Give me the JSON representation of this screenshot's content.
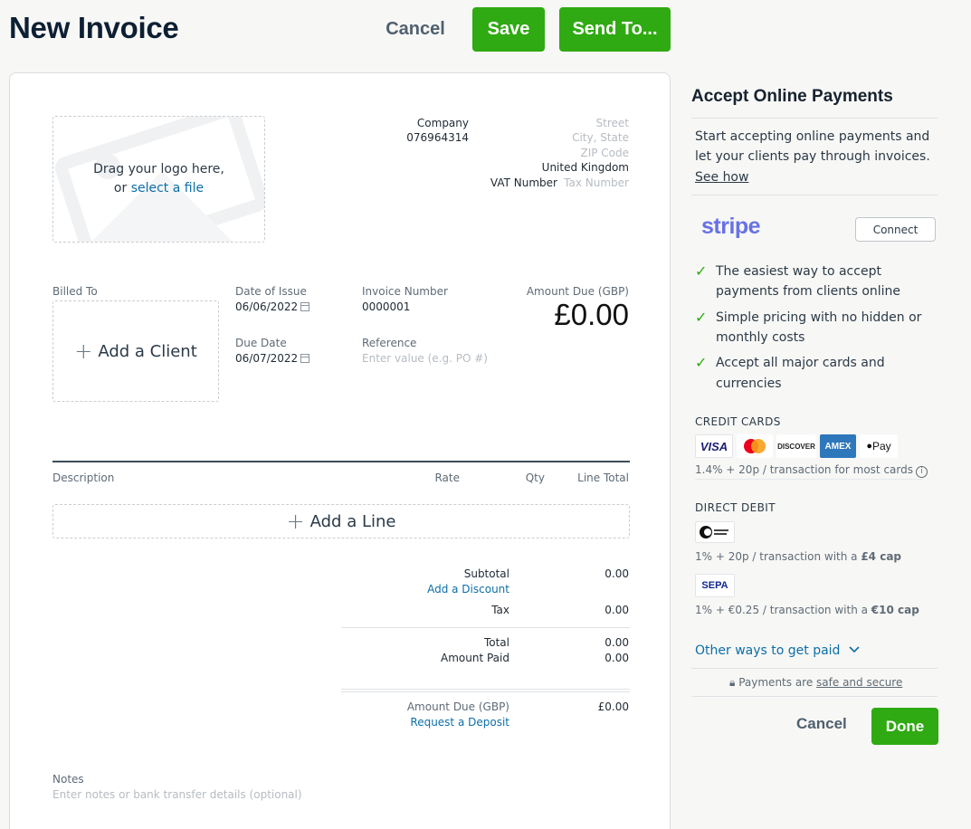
{
  "header": {
    "title": "New Invoice",
    "cancel_label": "Cancel",
    "save_label": "Save",
    "send_label": "Send To..."
  },
  "logo_drop": {
    "line1": "Drag your logo here,",
    "or_label": "or",
    "select_link": "select a file"
  },
  "company": {
    "name": "Company",
    "phone": "076964314",
    "street": "Street",
    "city_state": "City, State",
    "zip": "ZIP Code",
    "country": "United Kingdom",
    "vat_label": "VAT Number",
    "vat_placeholder": "Tax Number"
  },
  "details": {
    "billed_to_label": "Billed To",
    "add_client_label": "Add a Client",
    "date_of_issue_label": "Date of Issue",
    "date_of_issue": "06/06/2022",
    "due_date_label": "Due Date",
    "due_date": "06/07/2022",
    "invoice_number_label": "Invoice Number",
    "invoice_number": "0000001",
    "reference_label": "Reference",
    "reference_placeholder": "Enter value (e.g. PO #)",
    "amount_due_label": "Amount Due (GBP)",
    "amount_due": "£0.00"
  },
  "table": {
    "columns": [
      "Description",
      "Rate",
      "Qty",
      "Line Total"
    ],
    "add_line_label": "Add a Line"
  },
  "totals": {
    "subtotal_label": "Subtotal",
    "subtotal": "0.00",
    "add_discount": "Add a Discount",
    "tax_label": "Tax",
    "tax": "0.00",
    "total_label": "Total",
    "total": "0.00",
    "amount_paid_label": "Amount Paid",
    "amount_paid": "0.00",
    "amount_due_label": "Amount Due (GBP)",
    "amount_due": "£0.00",
    "request_deposit": "Request a Deposit"
  },
  "notes": {
    "label": "Notes",
    "placeholder": "Enter notes or bank transfer details (optional)"
  },
  "panel": {
    "title": "Accept Online Payments",
    "intro_line1": "Start accepting online payments and",
    "intro_line2": "let your clients pay through invoices.",
    "see_how": "See how",
    "stripe_label": "stripe",
    "connect_label": "Connect",
    "benefits": [
      {
        "line1": "The easiest way to accept",
        "line2": "payments from clients online"
      },
      {
        "line1": "Simple pricing with no hidden or",
        "line2": "monthly costs"
      },
      {
        "line1": "Accept all major cards and",
        "line2": "currencies"
      }
    ],
    "credit_cards_heading": "CREDIT CARDS",
    "cards": [
      "VISA",
      "DISCOVER",
      "AMEX",
      "Pay"
    ],
    "card_fee": "1.4% + 20p / transaction for most cards",
    "direct_debit_heading": "DIRECT DEBIT",
    "dd_fee_prefix": "1% + 20p / transaction with a ",
    "dd_fee_cap": "£4 cap",
    "sepa_label": "SEPA",
    "sepa_fee_prefix": "1% + €0.25 / transaction with a ",
    "sepa_fee_cap": "€10 cap",
    "other_ways": "Other ways to get paid",
    "secure_prefix": "Payments are ",
    "secure_link": "safe and secure",
    "cancel_label": "Cancel",
    "done_label": "Done",
    "colors": {
      "accent_green": "#2faa12",
      "link_blue": "#0d6ea8",
      "stripe_purple": "#6772e5"
    }
  }
}
